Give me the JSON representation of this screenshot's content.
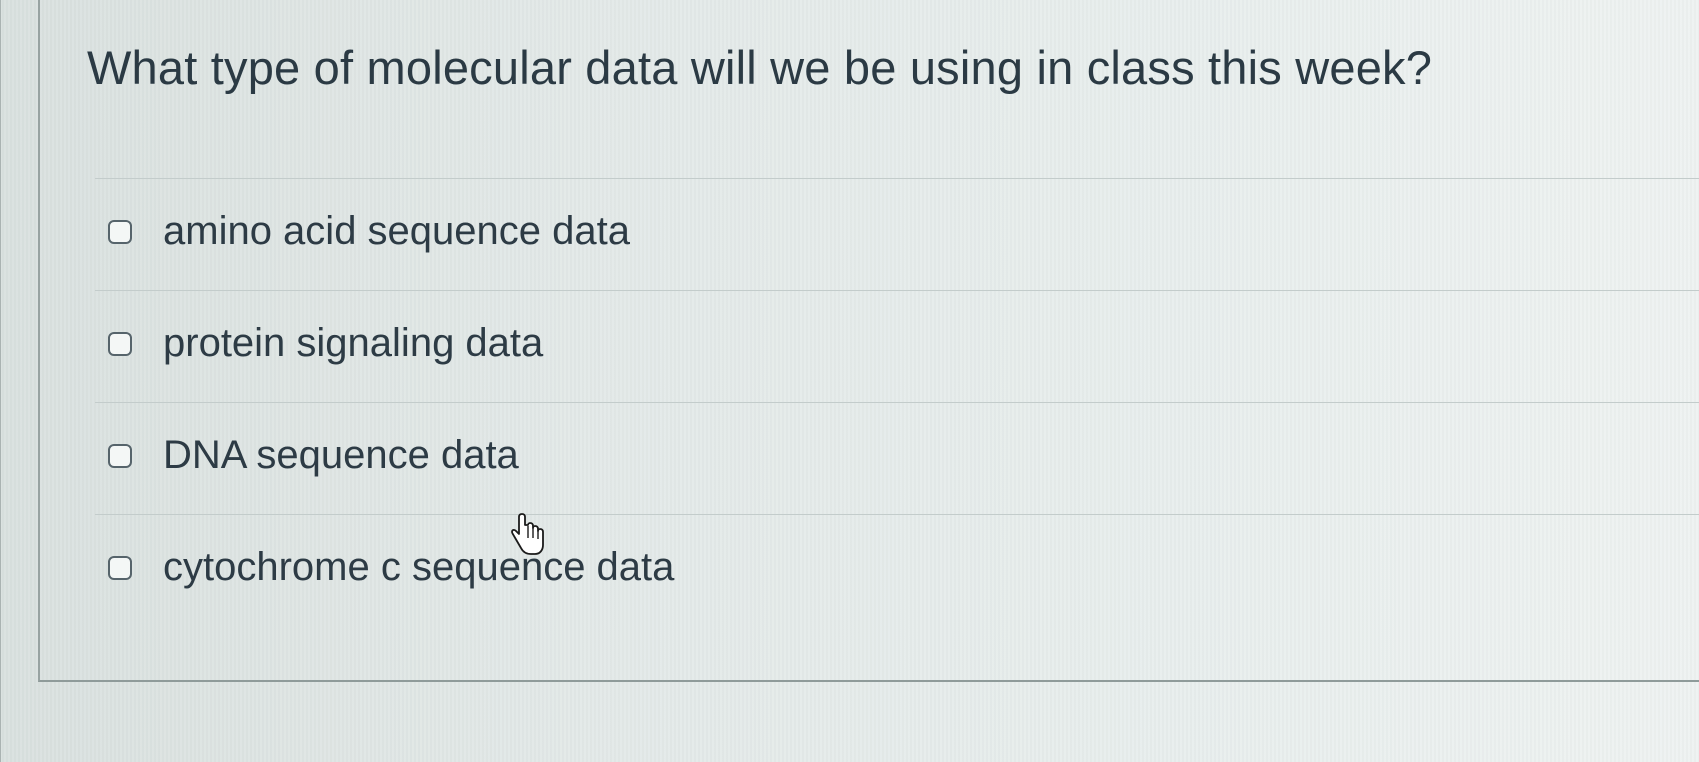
{
  "question": {
    "text": "What type of molecular data will we be using in class this week?"
  },
  "answers": [
    {
      "label": "amino acid sequence data",
      "checked": false
    },
    {
      "label": "protein signaling data",
      "checked": false
    },
    {
      "label": "DNA sequence data",
      "checked": false
    },
    {
      "label": "cytochrome c sequence data",
      "checked": false
    }
  ],
  "cursor": {
    "icon": "hand-pointer-icon"
  }
}
